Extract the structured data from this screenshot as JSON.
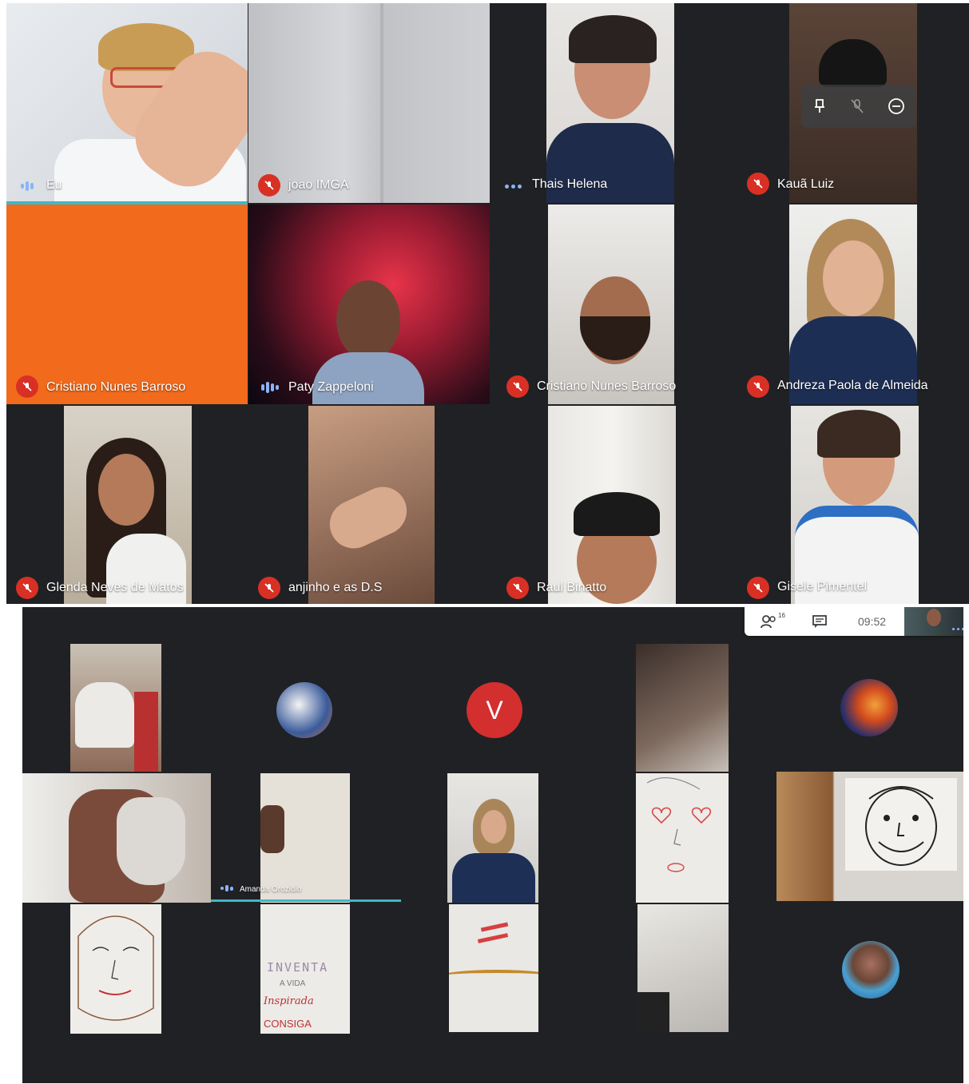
{
  "screen1": {
    "participants": [
      {
        "name": "Eu",
        "indicator": "speaking-wave"
      },
      {
        "name": "joao IMGA",
        "indicator": "mic-off"
      },
      {
        "name": "Thais Helena",
        "indicator": "speaking-dots"
      },
      {
        "name": "Kauã Luiz",
        "indicator": "mic-off"
      },
      {
        "name": "Cristiano Nunes Barroso",
        "indicator": "mic-off"
      },
      {
        "name": "Paty Zappeloni",
        "indicator": "speaking-wave"
      },
      {
        "name": "Cristiano Nunes Barroso",
        "indicator": "mic-off"
      },
      {
        "name": "Andreza Paola de Almeida",
        "indicator": "mic-off"
      },
      {
        "name": "Glenda Neves de Matos",
        "indicator": "mic-off"
      },
      {
        "name": "anjinho e as D.S",
        "indicator": "mic-off"
      },
      {
        "name": "Raul Binatto",
        "indicator": "mic-off"
      },
      {
        "name": "Gisele Pimentel",
        "indicator": "mic-off"
      }
    ],
    "hover_controls": [
      "pin-icon",
      "mute-icon",
      "remove-icon"
    ]
  },
  "screen2": {
    "topbar": {
      "people_icon": "people-icon",
      "people_count": "16",
      "chat_icon": "chat-icon",
      "time": "09:52"
    },
    "avatar_letter": "V",
    "speaker_name": "Amanda Orozidio",
    "drawing_texts": {
      "line1": "INVENTA",
      "line2": "A VIDA",
      "line3": "Inspirada",
      "line4": "CONSIGA"
    }
  },
  "colors": {
    "meet_dark": "#202124",
    "mic_red": "#d93025",
    "speaking_teal": "#3fb8c7",
    "avatar_red": "#d32f2f",
    "orange_tile": "#f26a1b"
  }
}
